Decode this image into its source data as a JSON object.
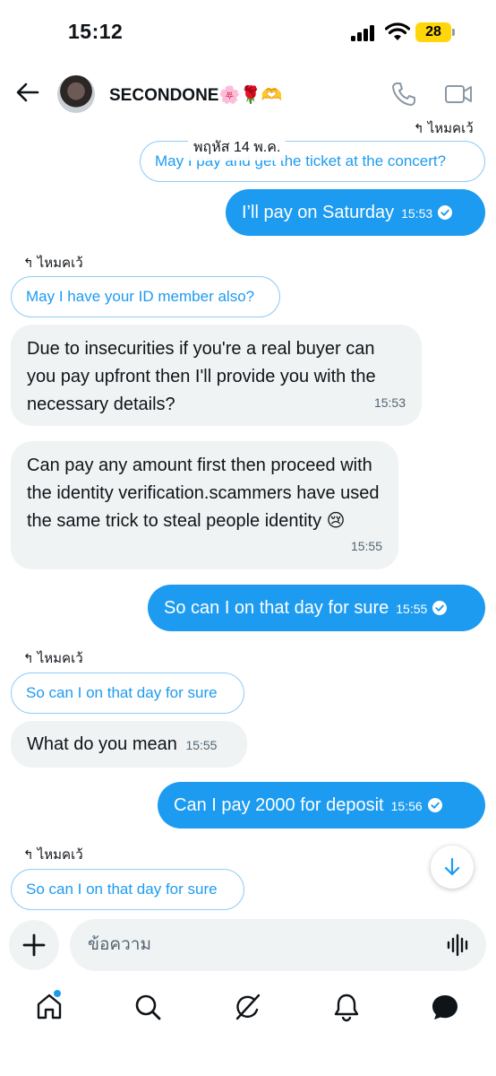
{
  "status": {
    "time": "15:12",
    "battery": "28"
  },
  "header": {
    "contact_name": "SECONDONE🌸🌹🫶"
  },
  "date_separator": "พฤหัส 14 พ.ค.",
  "reply_label": "ไหมคเว้",
  "messages": {
    "m1_quote": "May I pay and get the ticket at the concert?",
    "m2": {
      "text": "I’ll pay on Saturday",
      "time": "15:53"
    },
    "m3_quote": "May I have your ID member also?",
    "m4": {
      "text": "Due to insecurities if you're a real buyer can you pay upfront then I'll provide you with the necessary details?",
      "time": "15:53"
    },
    "m5": {
      "text": "Can pay any amount first then proceed with the identity verification.scammers have used the same trick to steal people identity 😢",
      "time": "15:55"
    },
    "m6": {
      "text": "So can I on that day for sure",
      "time": "15:55"
    },
    "m7_quote": "So can I on that day for sure",
    "m8": {
      "text": "What do you mean",
      "time": "15:55"
    },
    "m9": {
      "text": "Can I pay 2000 for deposit",
      "time": "15:56"
    },
    "m10_quote": "So can I on that day for sure"
  },
  "composer": {
    "placeholder": "ข้อความ"
  },
  "colors": {
    "accent": "#1d9bf0",
    "incoming_bg": "#eff3f4",
    "battery": "#ffd60a"
  },
  "icons": [
    "back-arrow-icon",
    "phone-icon",
    "video-icon",
    "reply-arrow-icon",
    "read-check-icon",
    "arrow-down-icon",
    "plus-icon",
    "voice-wave-icon",
    "home-icon",
    "search-icon",
    "grok-icon",
    "bell-icon",
    "messages-icon"
  ]
}
